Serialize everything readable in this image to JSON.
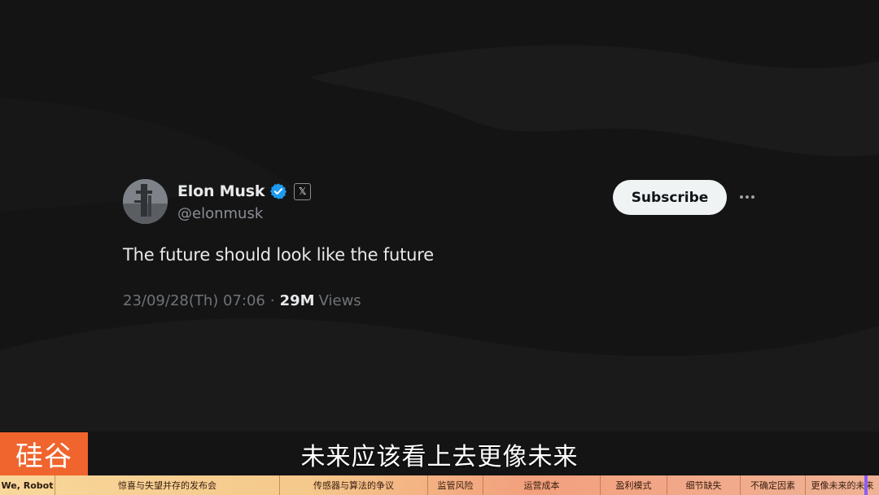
{
  "tweet": {
    "name": "Elon Musk",
    "handle": "@elonmusk",
    "x_badge": "𝕏",
    "subscribe_label": "Subscribe",
    "text": "The future should look like the future",
    "timestamp": "23/09/28(Th) 07:06",
    "separator": "·",
    "views_count": "29M",
    "views_label": "Views"
  },
  "overlay": {
    "logo_text": "硅谷",
    "subtitle": "未来应该看上去更像未来"
  },
  "chapters": [
    "We, Robot",
    "惊喜与失望并存的发布会",
    "传感器与算法的争议",
    "监管风险",
    "运营成本",
    "盈利模式",
    "细节缺失",
    "不确定因素",
    "更像未来的未来"
  ],
  "colors": {
    "verified": "#1d9bf0",
    "subscribe_bg": "#eff3f4",
    "logo_bg": "#f0642d",
    "progress_marker": "#8b5cf6"
  },
  "icons": {
    "verified": "verified-badge-icon",
    "x": "x-logo-icon",
    "more": "more-horizontal-icon"
  }
}
